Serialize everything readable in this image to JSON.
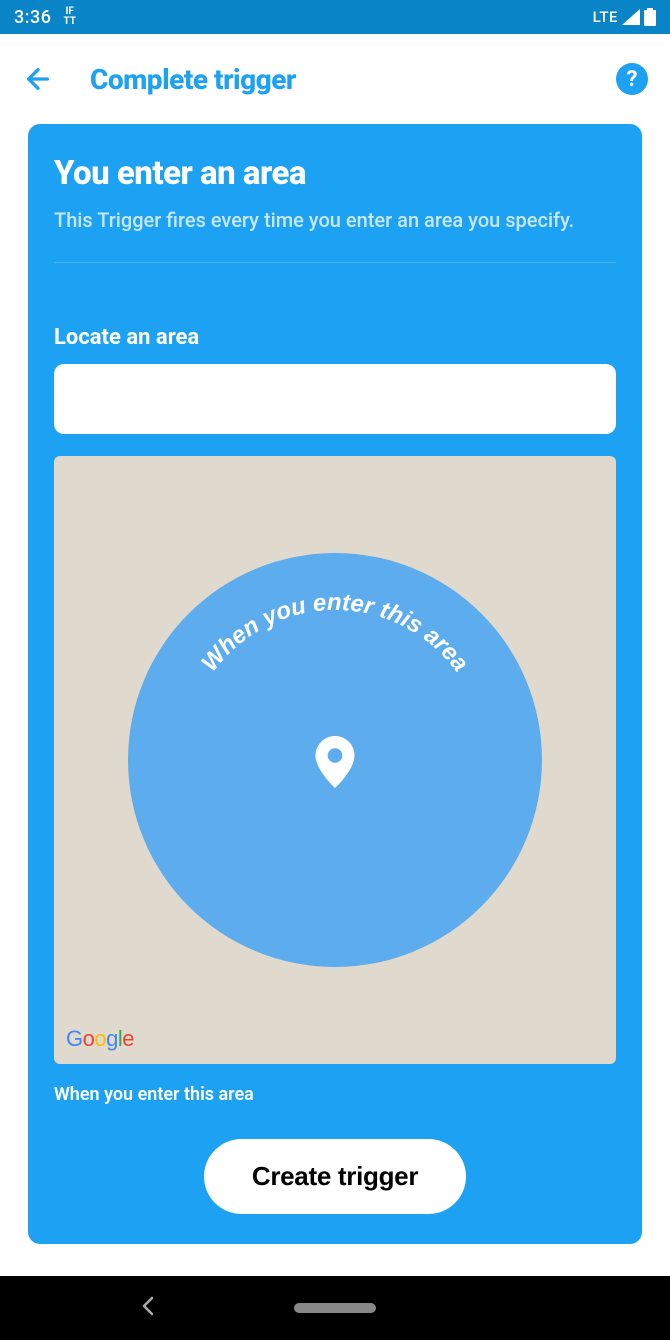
{
  "statusBar": {
    "time": "3:36",
    "appIcon": "IFTTT",
    "network": "LTE"
  },
  "header": {
    "title": "Complete trigger"
  },
  "card": {
    "title": "You enter an area",
    "description": "This Trigger fires every time you enter an area you specify.",
    "fieldLabel": "Locate an area",
    "inputValue": ""
  },
  "map": {
    "circleText": "When you enter this area",
    "attribution": "Google",
    "labelBelow": "When you enter this area"
  },
  "buttons": {
    "createTrigger": "Create trigger"
  }
}
